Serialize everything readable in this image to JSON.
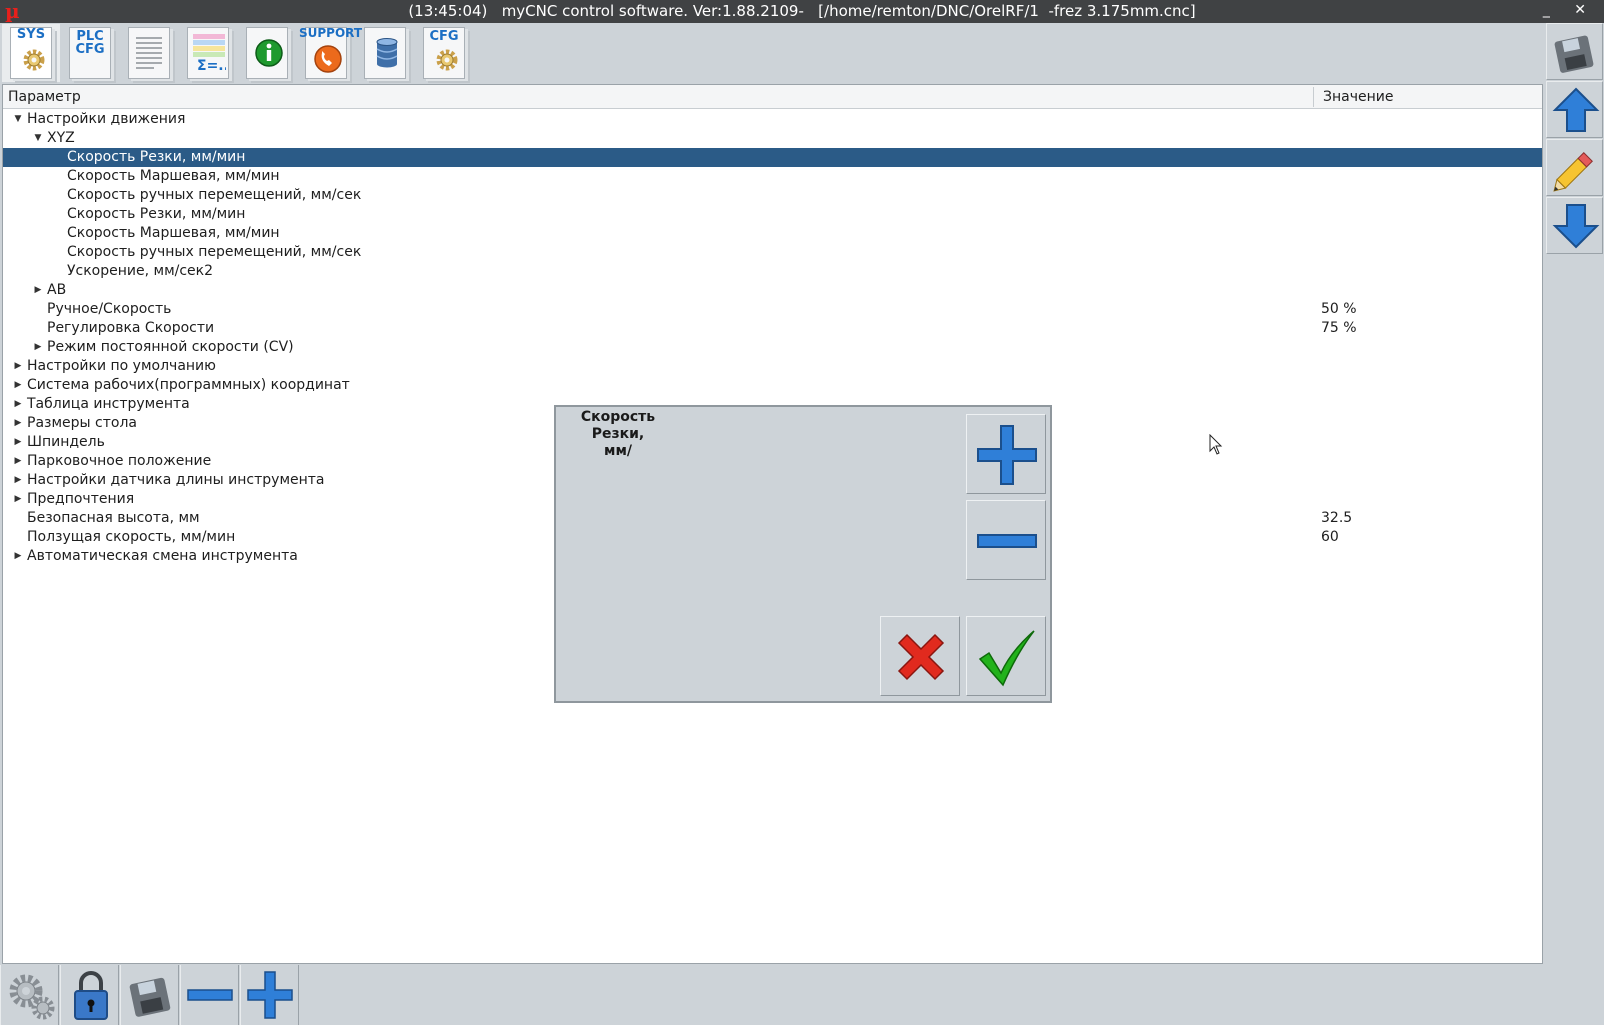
{
  "window": {
    "logo": "µ",
    "title": "(13:45:04)   myCNC control software. Ver:1.88.2109-   [/home/remton/DNC/OrelRF/1  -frez 3.175mm.cnc]",
    "controls": "_ ✕"
  },
  "toolbar": {
    "sys": "SYS",
    "plc_line1": "PLC",
    "plc_line2": "CFG",
    "support": "SUPPORT",
    "cfg": "CFG"
  },
  "tree": {
    "col_param": "Параметр",
    "col_value": "Значение",
    "rows": [
      {
        "label": "Настройки движения",
        "value": ""
      },
      {
        "label": "XYZ",
        "value": ""
      },
      {
        "label": "Скорость Резки, мм/мин",
        "value": ""
      },
      {
        "label": "Скорость Маршевая, мм/мин",
        "value": ""
      },
      {
        "label": "Скорость ручных перемещений, мм/сек",
        "value": ""
      },
      {
        "label": "Скорость Резки, мм/мин",
        "value": ""
      },
      {
        "label": "Скорость Маршевая, мм/мин",
        "value": ""
      },
      {
        "label": "Скорость ручных перемещений, мм/сек",
        "value": ""
      },
      {
        "label": "Ускорение, мм/сек2",
        "value": ""
      },
      {
        "label": "AB",
        "value": ""
      },
      {
        "label": "Ручное/Скорость",
        "value": "50 %"
      },
      {
        "label": "Регулировка Скорости",
        "value": "75 %"
      },
      {
        "label": "Режим постоянной скорости (CV)",
        "value": ""
      },
      {
        "label": "Настройки по умолчанию",
        "value": ""
      },
      {
        "label": "Система рабочих(программных) координат",
        "value": ""
      },
      {
        "label": "Таблица инструмента",
        "value": ""
      },
      {
        "label": "Размеры стола",
        "value": ""
      },
      {
        "label": "Шпиндель",
        "value": ""
      },
      {
        "label": "Парковочное положение",
        "value": ""
      },
      {
        "label": "Настройки датчика длины инструмента",
        "value": ""
      },
      {
        "label": "Предпочтения",
        "value": ""
      },
      {
        "label": "Безопасная высота, мм",
        "value": "32.5"
      },
      {
        "label": "Ползущая скорость, мм/мин",
        "value": "60"
      },
      {
        "label": "Автоматическая смена инструмента",
        "value": ""
      }
    ]
  },
  "dialog": {
    "title": "Скорость Резки, мм/"
  },
  "colors": {
    "selection": "#2b5b87",
    "accent_blue": "#2f7fd8",
    "cancel_red": "#e12a1e",
    "ok_green": "#22b21b"
  }
}
